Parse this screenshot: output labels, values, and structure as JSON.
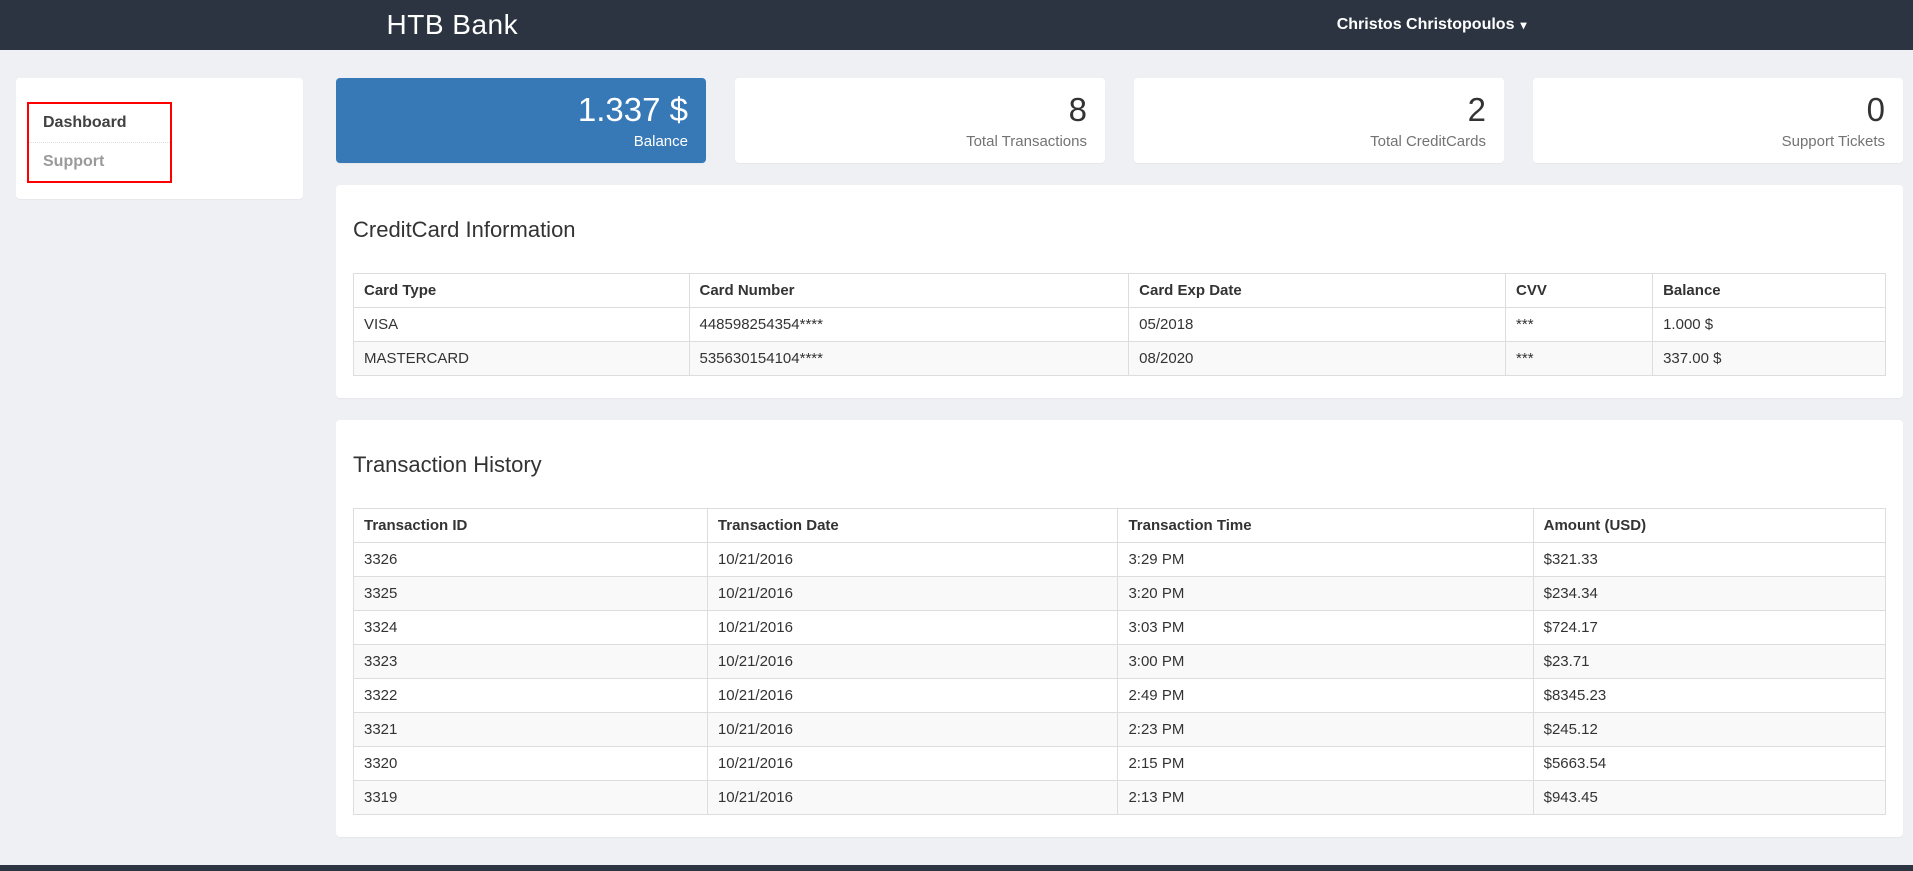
{
  "colors": {
    "navbar-bg": "#2b3440",
    "accent": "#3779b7",
    "highlight": "#ff0000",
    "page-bg": "#eef0f3"
  },
  "navbar": {
    "brand": "HTB Bank",
    "user": {
      "name": "Christos Christopoulos",
      "caret_icon": "▾"
    }
  },
  "sidebar": {
    "items": [
      {
        "label": "Dashboard",
        "active": true
      },
      {
        "label": "Support",
        "active": false
      }
    ]
  },
  "stats": [
    {
      "value": "1.337 $",
      "label": "Balance"
    },
    {
      "value": "8",
      "label": "Total Transactions"
    },
    {
      "value": "2",
      "label": "Total CreditCards"
    },
    {
      "value": "0",
      "label": "Support Tickets"
    }
  ],
  "creditcards": {
    "title": "CreditCard Information",
    "headers": [
      "Card Type",
      "Card Number",
      "Card Exp Date",
      "CVV",
      "Balance"
    ],
    "rows": [
      [
        "VISA",
        "448598254354****",
        "05/2018",
        "***",
        "1.000 $"
      ],
      [
        "MASTERCARD",
        "535630154104****",
        "08/2020",
        "***",
        "337.00 $"
      ]
    ]
  },
  "transactions": {
    "title": "Transaction History",
    "headers": [
      "Transaction ID",
      "Transaction Date",
      "Transaction Time",
      "Amount (USD)"
    ],
    "rows": [
      [
        "3326",
        "10/21/2016",
        "3:29 PM",
        "$321.33"
      ],
      [
        "3325",
        "10/21/2016",
        "3:20 PM",
        "$234.34"
      ],
      [
        "3324",
        "10/21/2016",
        "3:03 PM",
        "$724.17"
      ],
      [
        "3323",
        "10/21/2016",
        "3:00 PM",
        "$23.71"
      ],
      [
        "3322",
        "10/21/2016",
        "2:49 PM",
        "$8345.23"
      ],
      [
        "3321",
        "10/21/2016",
        "2:23 PM",
        "$245.12"
      ],
      [
        "3320",
        "10/21/2016",
        "2:15 PM",
        "$5663.54"
      ],
      [
        "3319",
        "10/21/2016",
        "2:13 PM",
        "$943.45"
      ]
    ]
  }
}
